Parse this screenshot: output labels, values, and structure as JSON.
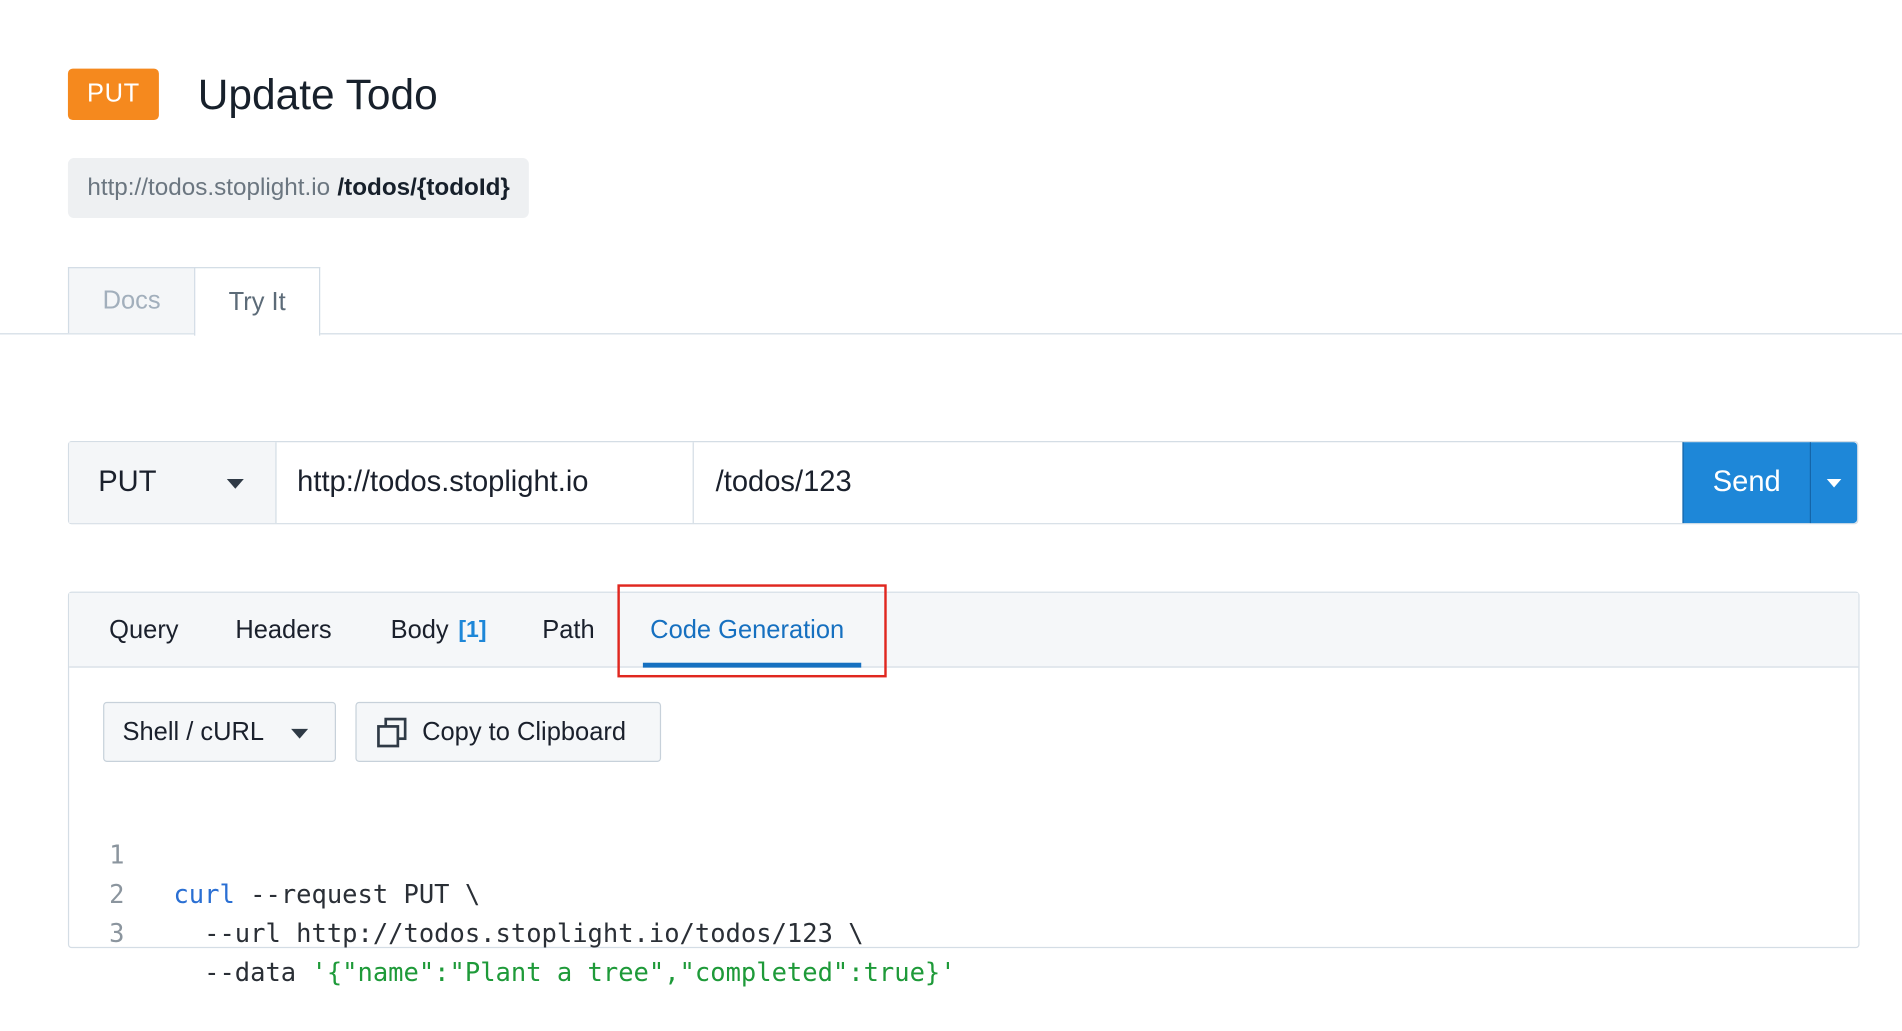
{
  "header": {
    "method_badge": "PUT",
    "title": "Update Todo",
    "url_host": "http://todos.stoplight.io",
    "url_path": "/todos/{todoId}"
  },
  "main_tabs": [
    {
      "label": "Docs",
      "active": false
    },
    {
      "label": "Try It",
      "active": true
    }
  ],
  "request": {
    "method": "PUT",
    "server": "http://todos.stoplight.io",
    "path": "/todos/123",
    "send_label": "Send"
  },
  "panel_tabs": {
    "query": "Query",
    "headers": "Headers",
    "body": "Body",
    "body_count": "[1]",
    "path": "Path",
    "code_generation": "Code Generation",
    "active": "Code Generation"
  },
  "codegen": {
    "language": "Shell / cURL",
    "copy_label": "Copy to Clipboard",
    "lines": [
      {
        "num": "1",
        "keyword": "curl",
        "text": " --request PUT \\"
      },
      {
        "num": "2",
        "text": "  --url http://todos.stoplight.io/todos/123 \\"
      },
      {
        "num": "3",
        "text": "  --data ",
        "string": "'{\"name\":\"Plant a tree\",\"completed\":true}'"
      }
    ]
  },
  "colors": {
    "put_badge": "#f5891e",
    "send_button": "#1e87d8",
    "active_tab": "#1670c0",
    "highlight": "#e0271f",
    "keyword": "#2a6fd3",
    "string": "#1e9a39"
  },
  "icons": [
    "chevron-down-icon",
    "copy-icon"
  ]
}
